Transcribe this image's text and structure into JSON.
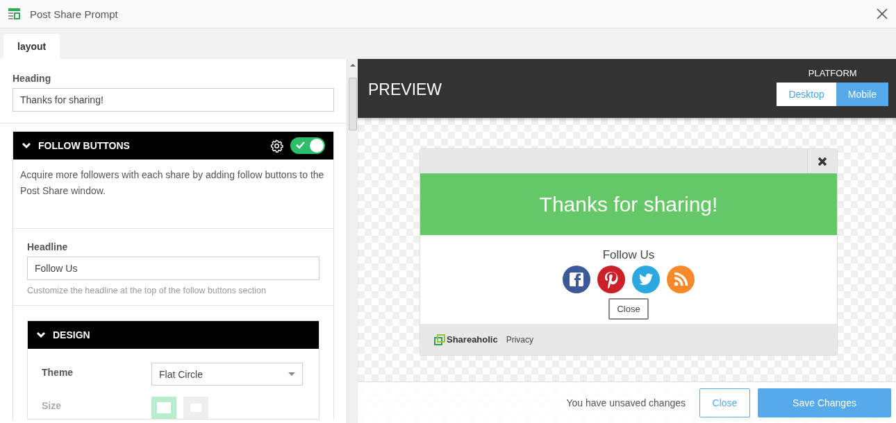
{
  "window": {
    "title": "Post Share Prompt"
  },
  "tabs": [
    {
      "label": "layout",
      "selected": true
    }
  ],
  "heading_field": {
    "label": "Heading",
    "value": "Thanks for sharing!"
  },
  "follow_section": {
    "title": "FOLLOW BUTTONS",
    "expanded": true,
    "on": true,
    "description": "Acquire more followers with each share by adding follow buttons to the Post Share window.",
    "headline_field": {
      "label": "Headline",
      "value": "Follow Us",
      "help": "Customize the headline at the top of the follow buttons section"
    },
    "design": {
      "title": "DESIGN",
      "expanded": true,
      "theme": {
        "label": "Theme",
        "value": "Flat Circle"
      },
      "size": {
        "label": "Size",
        "options": [
          {
            "selected": true
          },
          {
            "selected": false
          }
        ]
      }
    }
  },
  "preview": {
    "title": "PREVIEW",
    "platform_label": "PLATFORM",
    "platforms": [
      {
        "label": "Desktop",
        "selected": false
      },
      {
        "label": "Mobile",
        "selected": true
      }
    ],
    "popup": {
      "heading": "Thanks for sharing!",
      "follow_label": "Follow Us",
      "networks": [
        {
          "kind": "facebook"
        },
        {
          "kind": "pinterest"
        },
        {
          "kind": "twitter"
        },
        {
          "kind": "rss"
        }
      ],
      "close_label": "Close",
      "brand": "Shareaholic",
      "privacy": "Privacy"
    }
  },
  "footer": {
    "status": "You have unsaved changes",
    "buttons": [
      {
        "label": "Close",
        "kind": "secondary"
      },
      {
        "label": "Save Changes",
        "kind": "primary"
      }
    ]
  }
}
